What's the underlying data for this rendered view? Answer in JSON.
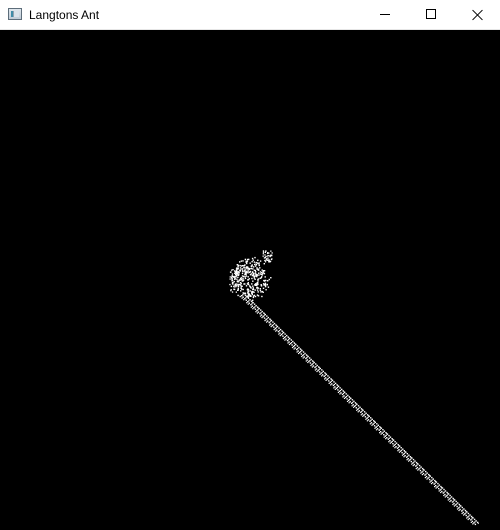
{
  "window": {
    "title": "Langtons Ant",
    "icon": "application-window-icon",
    "controls": {
      "minimize": "minimize-icon",
      "maximize": "maximize-icon",
      "close": "close-icon"
    }
  },
  "canvas": {
    "background_color": "#000000",
    "cell_color": "#ffffff",
    "pattern": "langtons-ant-highway"
  }
}
